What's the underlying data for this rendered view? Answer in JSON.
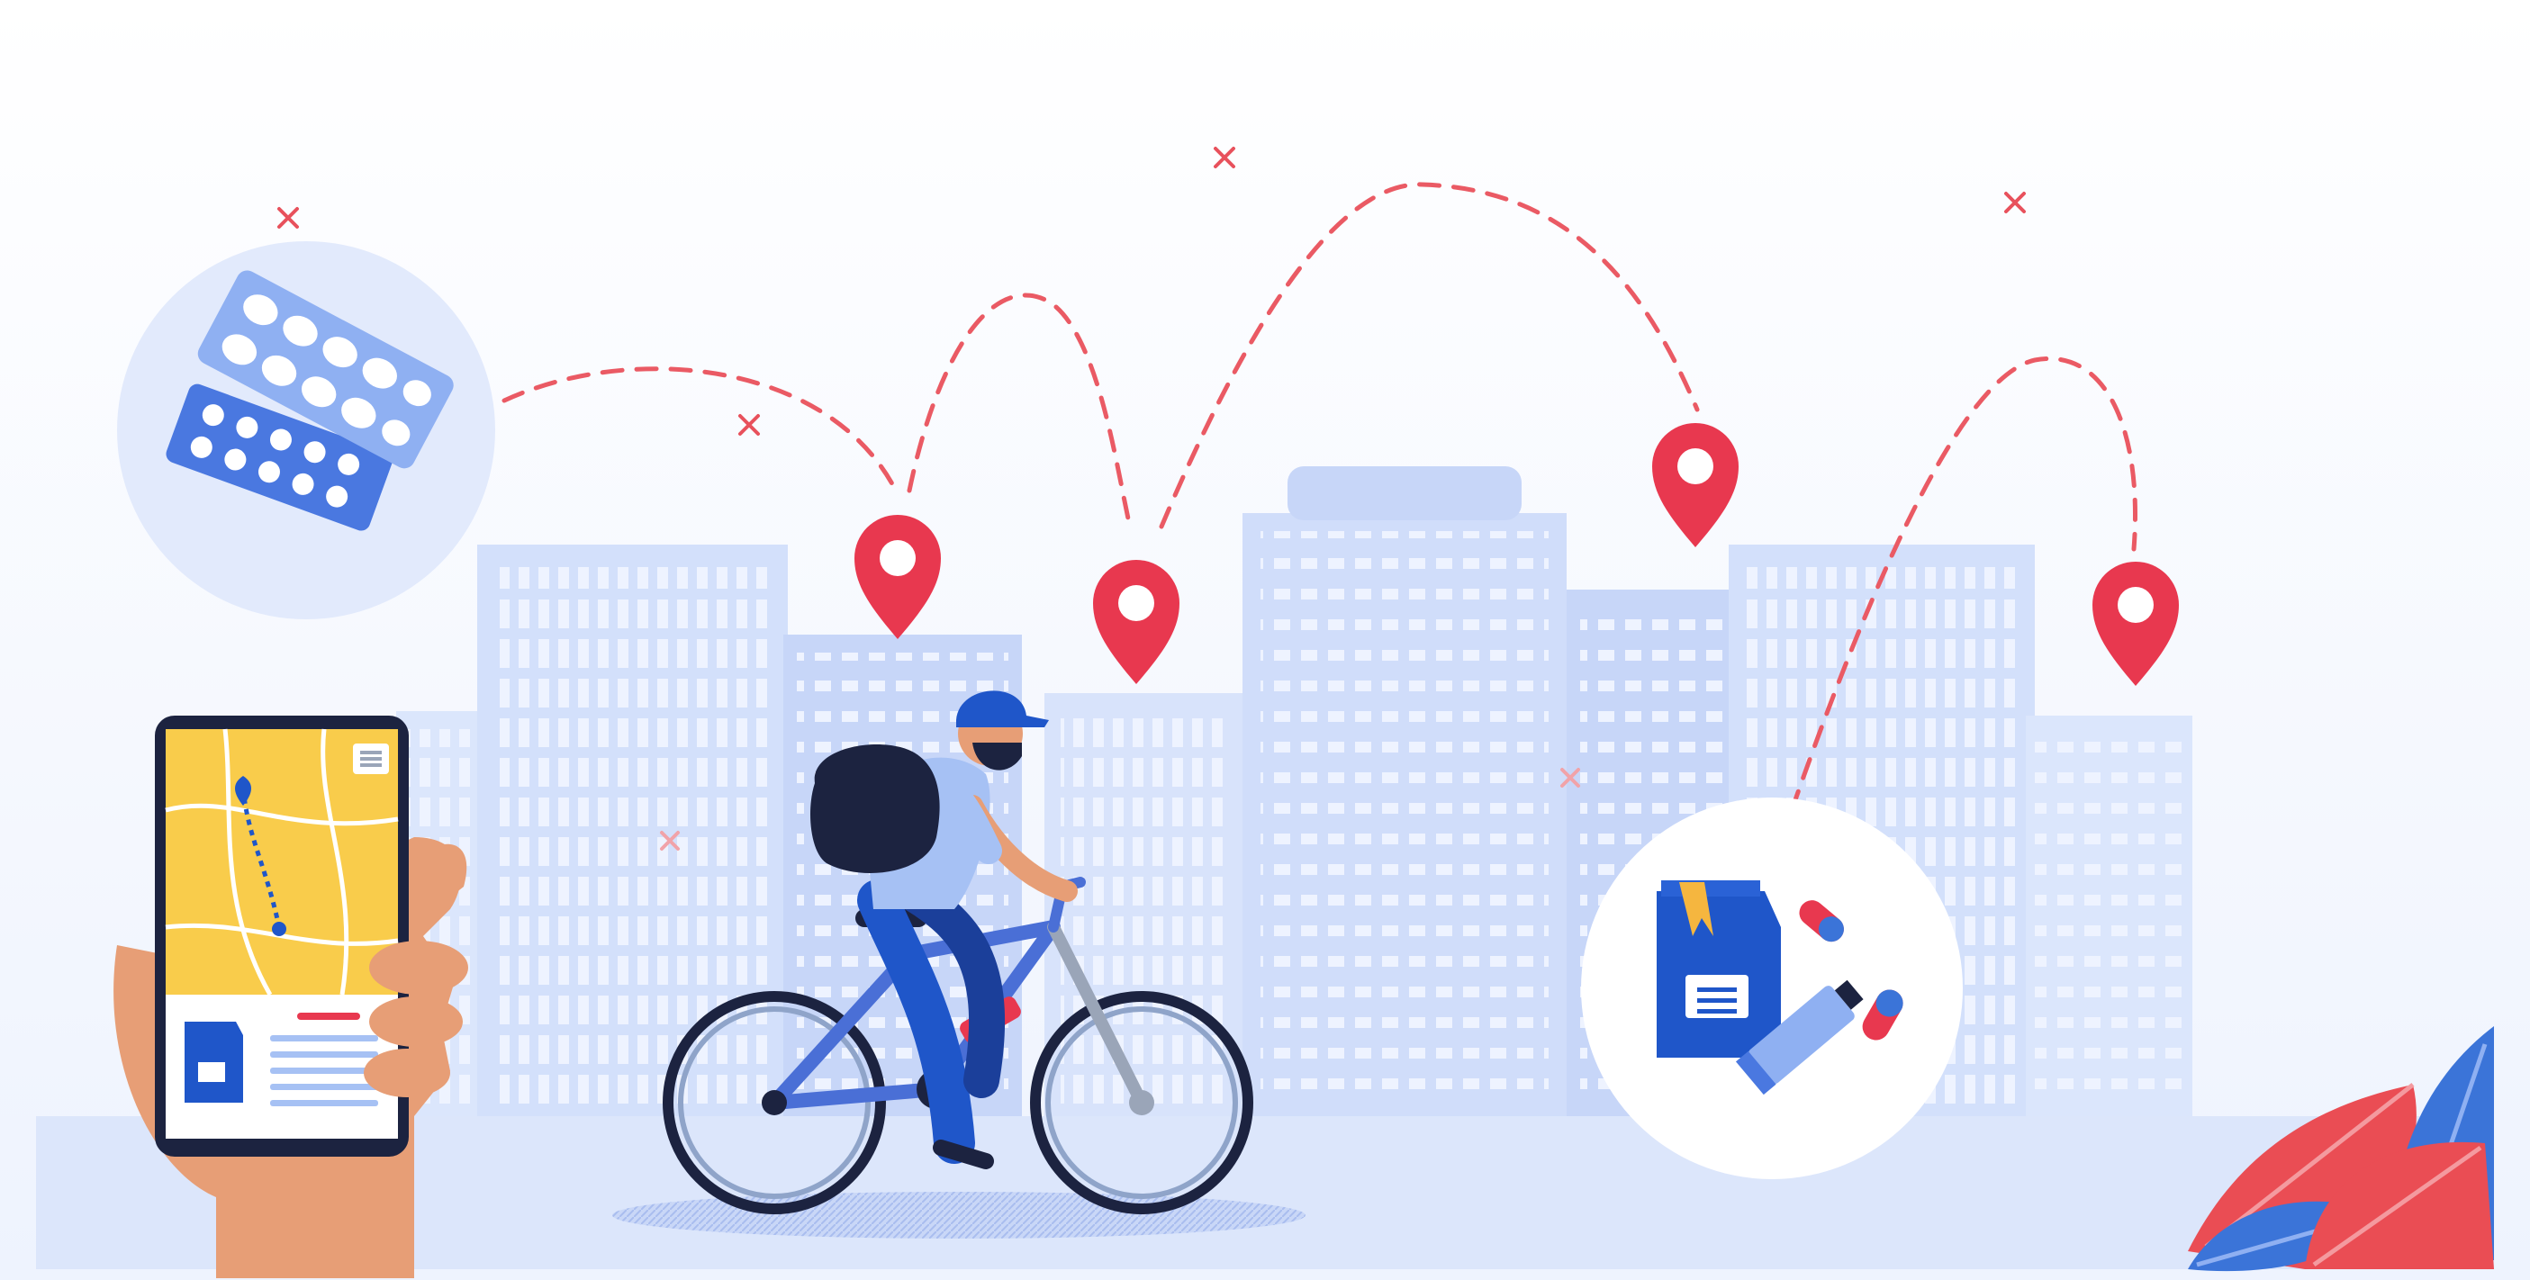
{
  "illustration": {
    "subject": "medicine-delivery-by-bicycle",
    "colors": {
      "sky_top": "#ffffff",
      "sky_bottom": "#eef3fe",
      "ground": "#dce6fb",
      "building_light": "#dbe6fc",
      "building_mid": "#c7d6f8",
      "window": "#eef3ff",
      "pin_red": "#e8384f",
      "route_red": "#ea5a64",
      "blue_dark": "#1f56c9",
      "blue_mid": "#4a78e0",
      "navy": "#1c2340",
      "skin": "#e79e76",
      "phone_map": "#f9cc4b",
      "leaf_red": "#ea4d54",
      "leaf_blue": "#3b74d8"
    },
    "icons": [
      "pill-blister-icon",
      "map-pin-icon",
      "delivery-bag-icon",
      "capsule-icon",
      "ointment-tube-icon",
      "smartphone-icon",
      "bicycle-icon",
      "cross-mark-icon",
      "leaf-icon"
    ]
  }
}
